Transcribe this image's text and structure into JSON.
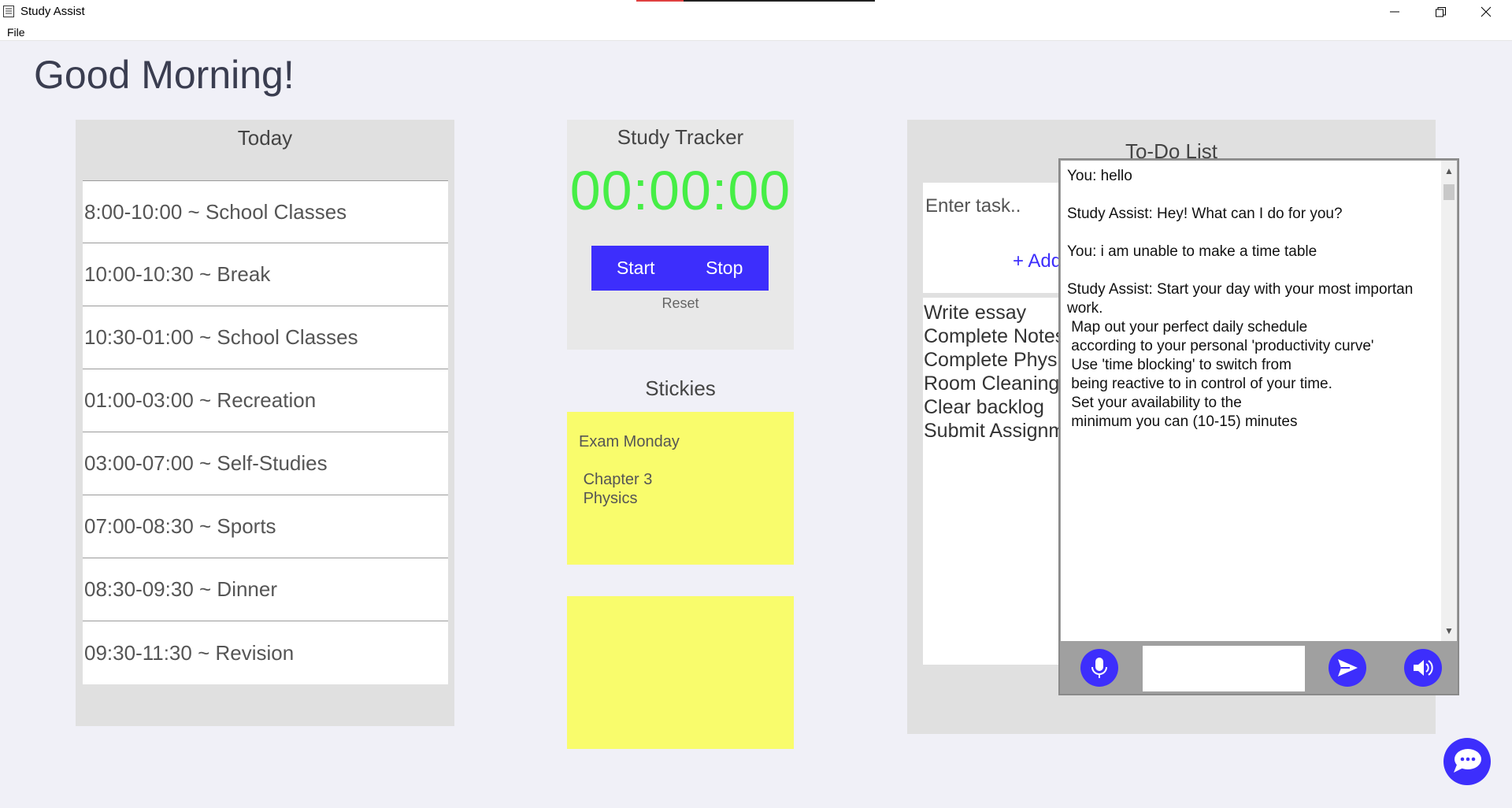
{
  "window": {
    "title": "Study Assist",
    "menu": [
      "File"
    ]
  },
  "greeting": "Good Morning!",
  "today": {
    "title": "Today",
    "items": [
      "8:00-10:00 ~ School Classes",
      "10:00-10:30 ~ Break",
      "10:30-01:00 ~ School Classes",
      "01:00-03:00 ~ Recreation",
      "03:00-07:00 ~ Self-Studies",
      "07:00-08:30 ~ Sports",
      "08:30-09:30 ~ Dinner",
      "09:30-11:30 ~ Revision"
    ]
  },
  "tracker": {
    "title": "Study Tracker",
    "time": "00:00:00",
    "start_label": "Start",
    "stop_label": "Stop",
    "reset_label": "Reset"
  },
  "stickies": {
    "title": "Stickies",
    "notes": [
      "Exam Monday\n\n Chapter 3\n Physics",
      ""
    ]
  },
  "todo": {
    "title": "To-Do List",
    "input_placeholder": "Enter task..",
    "add_label": "+   Add",
    "items": [
      "Write essay",
      "Complete Notes",
      "Complete Physi",
      "Room Cleaning",
      "Clear backlog",
      "Submit Assignm"
    ]
  },
  "chat": {
    "log": "You: hello\n\nStudy Assist: Hey! What can I do for you?\n\nYou: i am unable to make a time table\n\nStudy Assist: Start your day with your most importan\nwork.\n Map out your perfect daily schedule\n according to your personal 'productivity curve'\n Use 'time blocking' to switch from\n being reactive to in control of your time.\n Set your availability to the\n minimum you can (10-15) minutes",
    "input_value": "",
    "icons": [
      "microphone-icon",
      "send-icon",
      "speaker-icon"
    ]
  },
  "colors": {
    "accent": "#3d2efc",
    "timer": "#46ee46",
    "sticky": "#f9fc6c",
    "background": "#f0f0f7"
  }
}
